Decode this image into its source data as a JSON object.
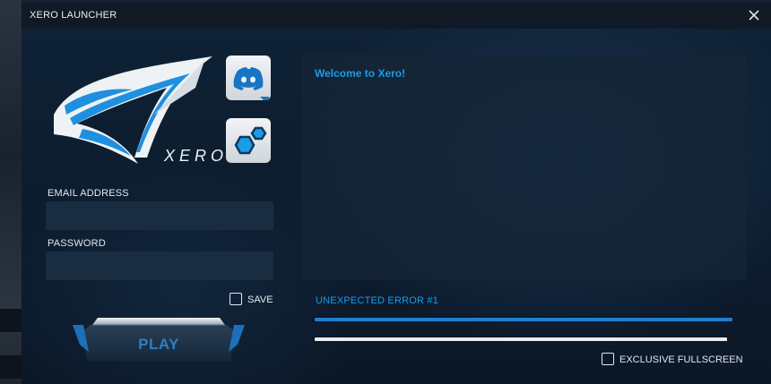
{
  "window": {
    "title": "XERO LAUNCHER",
    "close_icon": "close-icon"
  },
  "brand": {
    "logo_text": "XERO",
    "accent_color": "#1c9be6"
  },
  "social": {
    "discord_icon": "discord-icon",
    "hexagons_icon": "hexagons-icon"
  },
  "login": {
    "email_label": "EMAIL ADDRESS",
    "email_value": "",
    "password_label": "PASSWORD",
    "password_value": "",
    "save_label": "SAVE",
    "save_checked": false,
    "play_label": "PLAY"
  },
  "news": {
    "text": "Welcome to Xero!"
  },
  "status": {
    "message": "UNEXPECTED ERROR #1",
    "primary_progress": 1.0,
    "primary_color": "#1e7fd0",
    "secondary_progress": 1.0,
    "secondary_color": "#e8ecf0"
  },
  "options": {
    "fullscreen_label": "EXCLUSIVE FULLSCREEN",
    "fullscreen_checked": false
  }
}
